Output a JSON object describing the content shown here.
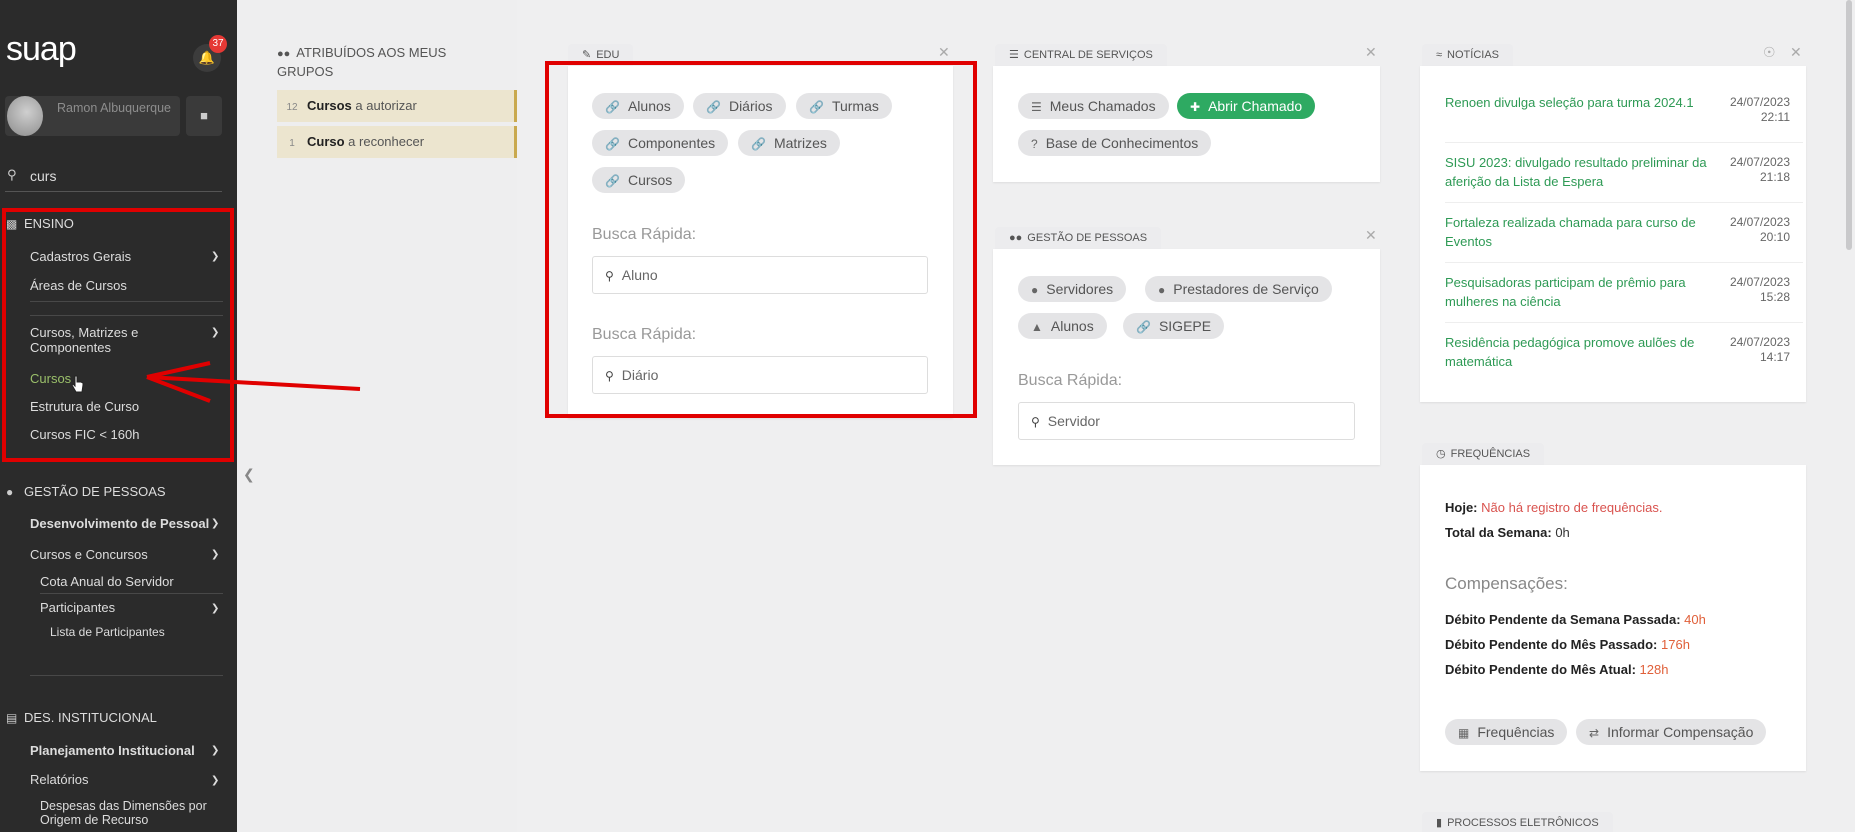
{
  "sidebar": {
    "logo": "suap",
    "notifications_count": "37",
    "user_name": "Ramon Albuquerque",
    "search_value": "curs",
    "ensino": {
      "header": "ENSINO",
      "items": [
        "Cadastros Gerais",
        "Áreas de Cursos",
        "Cursos, Matrizes e Componentes",
        "Cursos",
        "Estrutura de Curso",
        "Cursos FIC < 160h"
      ]
    },
    "gestao": {
      "header": "GESTÃO DE PESSOAS",
      "items": [
        "Desenvolvimento de Pessoal",
        "Cursos e Concursos",
        "Cota Anual do Servidor",
        "Participantes",
        "Lista de Participantes"
      ]
    },
    "desinst": {
      "header": "DES. INSTITUCIONAL",
      "items": [
        "Planejamento Institucional",
        "Relatórios",
        "Despesas das Dimensões por Origem de Recurso"
      ]
    }
  },
  "groups": {
    "title": "ATRIBUÍDOS AOS MEUS GRUPOS",
    "rows": [
      {
        "count": "12",
        "bold": "Cursos",
        "rest": " a autorizar"
      },
      {
        "count": "1",
        "bold": "Curso",
        "rest": " a reconhecer"
      }
    ]
  },
  "edu": {
    "tab": "EDU",
    "links": [
      "Alunos",
      "Diários",
      "Turmas",
      "Componentes",
      "Matrizes",
      "Cursos"
    ],
    "busca_label": "Busca Rápida:",
    "busca1": "Aluno",
    "busca2": "Diário"
  },
  "central": {
    "tab": "CENTRAL DE SERVIÇOS",
    "meus_chamados": "Meus Chamados",
    "abrir_chamado": "Abrir Chamado",
    "base": "Base de Conhecimentos"
  },
  "gestao_card": {
    "tab": "GESTÃO DE PESSOAS",
    "links": [
      "Servidores",
      "Prestadores de Serviço",
      "Alunos",
      "SIGEPE"
    ],
    "busca_label": "Busca Rápida:",
    "busca": "Servidor"
  },
  "noticias": {
    "tab": "NOTÍCIAS",
    "items": [
      {
        "title": "Renoen divulga seleção para turma 2024.1",
        "date": "24/07/2023",
        "time": "22:11"
      },
      {
        "title": "SISU 2023: divulgado resultado preliminar da aferição da Lista de Espera",
        "date": "24/07/2023",
        "time": "21:18"
      },
      {
        "title": "Fortaleza realizada chamada para curso de Eventos",
        "date": "24/07/2023",
        "time": "20:10"
      },
      {
        "title": "Pesquisadoras participam de prêmio para mulheres na ciência",
        "date": "24/07/2023",
        "time": "15:28"
      },
      {
        "title": "Residência pedagógica promove aulões de matemática",
        "date": "24/07/2023",
        "time": "14:17"
      }
    ]
  },
  "frequencias": {
    "tab": "FREQUÊNCIAS",
    "hoje_label": "Hoje:",
    "hoje_value": "Não há registro de frequências.",
    "semana_label": "Total da Semana:",
    "semana_value": "0h",
    "compensacoes": "Compensações:",
    "deb1_label": "Débito Pendente da Semana Passada:",
    "deb1_value": "40h",
    "deb2_label": "Débito Pendente do Mês Passado:",
    "deb2_value": "176h",
    "deb3_label": "Débito Pendente do Mês Atual:",
    "deb3_value": "128h",
    "btn_freq": "Frequências",
    "btn_comp": "Informar Compensação"
  },
  "processos": {
    "tab": "PROCESSOS ELETRÔNICOS"
  },
  "colors": {
    "highlight_red": "#e00000",
    "news_green": "#2e9a55",
    "button_green": "#2eaa62",
    "sidebar_bg": "#2b2b2b"
  }
}
